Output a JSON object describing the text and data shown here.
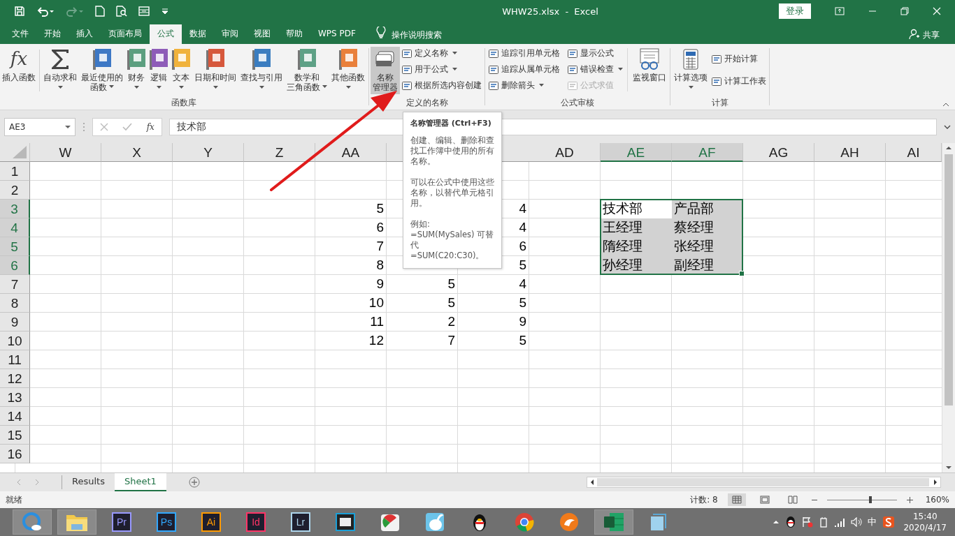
{
  "window": {
    "title": "WHW25.xlsx  -  Excel",
    "login_button": "登录"
  },
  "ribbon_tabs": [
    {
      "label": "文件",
      "selected": false
    },
    {
      "label": "开始",
      "selected": false
    },
    {
      "label": "插入",
      "selected": false
    },
    {
      "label": "页面布局",
      "selected": false
    },
    {
      "label": "公式",
      "selected": true
    },
    {
      "label": "数据",
      "selected": false
    },
    {
      "label": "审阅",
      "selected": false
    },
    {
      "label": "视图",
      "selected": false
    },
    {
      "label": "帮助",
      "selected": false
    },
    {
      "label": "WPS PDF",
      "selected": false
    }
  ],
  "tell_me": "操作说明搜索",
  "share": "共享",
  "ribbon_groups": [
    {
      "label": "函数库",
      "large": [
        {
          "lines": [
            "插入函数"
          ],
          "kind": "glyph",
          "glyph": "fx",
          "dropdown": false,
          "pressed": false
        },
        {
          "lines": [
            "自动求和"
          ],
          "kind": "sum",
          "dropdown": true,
          "pressed": false
        },
        {
          "lines": [
            "最近使用的",
            "函数"
          ],
          "kind": "book",
          "color": "#3d78c5",
          "dropdown": true,
          "pressed": false
        },
        {
          "lines": [
            "财务"
          ],
          "kind": "book",
          "color": "#5c9f7f",
          "dropdown": true,
          "pressed": false
        },
        {
          "lines": [
            "逻辑"
          ],
          "kind": "book",
          "color": "#8e5cb8",
          "dropdown": true,
          "pressed": false
        },
        {
          "lines": [
            "文本"
          ],
          "kind": "book",
          "color": "#f0b23c",
          "dropdown": true,
          "pressed": false
        },
        {
          "lines": [
            "日期和时间"
          ],
          "kind": "book",
          "color": "#d6583c",
          "dropdown": true,
          "pressed": false
        },
        {
          "lines": [
            "查找与引用"
          ],
          "kind": "book",
          "color": "#3a7dc0",
          "dropdown": true,
          "pressed": false
        },
        {
          "lines": [
            "数学和",
            "三角函数"
          ],
          "kind": "book",
          "color": "#5ea186",
          "dropdown": true,
          "pressed": false
        },
        {
          "lines": [
            "其他函数"
          ],
          "kind": "book",
          "color": "#e9803b",
          "dropdown": true,
          "pressed": false
        }
      ]
    },
    {
      "label": "定义的名称",
      "large": [
        {
          "lines": [
            "名称",
            "管理器"
          ],
          "kind": "names",
          "dropdown": false,
          "pressed": true
        }
      ],
      "small": [
        {
          "label": "定义名称",
          "dropdown": true,
          "disabled": false
        },
        {
          "label": "用于公式",
          "dropdown": true,
          "disabled": false
        },
        {
          "label": "根据所选内容创建",
          "dropdown": false,
          "disabled": false
        }
      ]
    },
    {
      "label": "公式审核",
      "small": [
        {
          "label": "追踪引用单元格",
          "dropdown": false,
          "disabled": false
        },
        {
          "label": "追踪从属单元格",
          "dropdown": false,
          "disabled": false
        },
        {
          "label": "删除箭头",
          "dropdown": true,
          "disabled": false
        },
        {
          "label": "显示公式",
          "dropdown": false,
          "disabled": false
        },
        {
          "label": "错误检查",
          "dropdown": true,
          "disabled": false
        },
        {
          "label": "公式求值",
          "dropdown": false,
          "disabled": true
        }
      ],
      "after": [
        {
          "lines": [
            "监视窗口"
          ],
          "kind": "watch",
          "dropdown": false,
          "pressed": false
        }
      ]
    },
    {
      "label": "计算",
      "large": [
        {
          "lines": [
            "计算选项"
          ],
          "kind": "calc",
          "dropdown": true,
          "pressed": false
        }
      ],
      "small": [
        {
          "label": "开始计算",
          "dropdown": false,
          "disabled": false
        },
        {
          "label": "计算工作表",
          "dropdown": false,
          "disabled": false
        }
      ]
    }
  ],
  "formula_bar": {
    "name_box": "AE3",
    "fx": "fx",
    "formula": "技术部"
  },
  "tooltip": {
    "title": "名称管理器 (Ctrl+F3)",
    "paragraphs": [
      "创建、编辑、删除和查找工作簿中使用的所有名称。",
      "可以在公式中使用这些名称，以替代单元格引用。",
      "例如:\n=SUM(MySales) 可替代\n=SUM(C20:C30)。"
    ]
  },
  "columns": [
    {
      "label": "W",
      "selected": false
    },
    {
      "label": "X",
      "selected": false
    },
    {
      "label": "Y",
      "selected": false
    },
    {
      "label": "Z",
      "selected": false
    },
    {
      "label": "AA",
      "selected": false
    },
    {
      "selected": false
    },
    {
      "selected": false
    },
    {
      "label": "AD",
      "selected": false
    },
    {
      "label": "AE",
      "selected": true
    },
    {
      "label": "AF",
      "selected": true
    },
    {
      "label": "AG",
      "selected": false
    },
    {
      "label": "AH",
      "selected": false
    },
    {
      "label": "AI",
      "selected": false
    }
  ],
  "rows": [
    {
      "label": "1",
      "selected": false
    },
    {
      "label": "2",
      "selected": false
    },
    {
      "label": "3",
      "selected": true,
      "cells": [
        null,
        null,
        null,
        null,
        {
          "value": "5",
          "kind": "number"
        },
        null,
        {
          "value": "4",
          "kind": "number"
        },
        null,
        {
          "value": "技术部",
          "kind": "text",
          "active": true
        },
        {
          "value": "产品部",
          "kind": "text",
          "active": false
        }
      ]
    },
    {
      "label": "4",
      "selected": true,
      "cells": [
        null,
        null,
        null,
        null,
        {
          "value": "6",
          "kind": "number"
        },
        null,
        {
          "value": "4",
          "kind": "number"
        },
        null,
        {
          "value": "王经理",
          "kind": "text",
          "active": false
        },
        {
          "value": "蔡经理",
          "kind": "text",
          "active": false
        }
      ]
    },
    {
      "label": "5",
      "selected": true,
      "cells": [
        null,
        null,
        null,
        null,
        {
          "value": "7",
          "kind": "number"
        },
        null,
        {
          "value": "6",
          "kind": "number"
        },
        null,
        {
          "value": "隋经理",
          "kind": "text",
          "active": false
        },
        {
          "value": "张经理",
          "kind": "text",
          "active": false
        }
      ]
    },
    {
      "label": "6",
      "selected": true,
      "cells": [
        null,
        null,
        null,
        null,
        {
          "value": "8",
          "kind": "number"
        },
        null,
        {
          "value": "5",
          "kind": "number"
        },
        null,
        {
          "value": "孙经理",
          "kind": "text",
          "active": false
        },
        {
          "value": "副经理",
          "kind": "text",
          "active": false
        }
      ]
    },
    {
      "label": "7",
      "selected": false,
      "cells": [
        null,
        null,
        null,
        null,
        {
          "value": "9",
          "kind": "number"
        },
        {
          "value": "5",
          "kind": "number"
        },
        {
          "value": "4",
          "kind": "number"
        }
      ]
    },
    {
      "label": "8",
      "selected": false,
      "cells": [
        null,
        null,
        null,
        null,
        {
          "value": "10",
          "kind": "number"
        },
        {
          "value": "5",
          "kind": "number"
        },
        {
          "value": "5",
          "kind": "number"
        }
      ]
    },
    {
      "label": "9",
      "selected": false,
      "cells": [
        null,
        null,
        null,
        null,
        {
          "value": "11",
          "kind": "number"
        },
        {
          "value": "2",
          "kind": "number"
        },
        {
          "value": "9",
          "kind": "number"
        }
      ]
    },
    {
      "label": "10",
      "selected": false,
      "cells": [
        null,
        null,
        null,
        null,
        {
          "value": "12",
          "kind": "number"
        },
        {
          "value": "7",
          "kind": "number"
        },
        {
          "value": "5",
          "kind": "number"
        }
      ]
    },
    {
      "label": "11",
      "selected": false
    },
    {
      "label": "12",
      "selected": false
    },
    {
      "label": "13",
      "selected": false
    },
    {
      "label": "14",
      "selected": false
    },
    {
      "label": "15",
      "selected": false
    },
    {
      "label": "16",
      "selected": false
    }
  ],
  "sheet_tabs": [
    {
      "label": "Results",
      "selected": false
    },
    {
      "label": "Sheet1",
      "selected": true
    }
  ],
  "status_bar": {
    "state": "就绪",
    "count": "计数: 8",
    "zoom": "160%",
    "level": 0.6
  },
  "taskbar": {
    "apps": [
      {
        "kind": "browser",
        "active": true
      },
      {
        "kind": "folder",
        "active": true
      },
      {
        "kind": "letters",
        "label": "Pr",
        "color": "#9999ff",
        "active": false
      },
      {
        "kind": "letters",
        "label": "Ps",
        "color": "#31a8ff",
        "active": false
      },
      {
        "kind": "letters",
        "label": "Ai",
        "color": "#ff9a00",
        "active": false
      },
      {
        "kind": "letters",
        "label": "Id",
        "color": "#ff3366",
        "active": false
      },
      {
        "kind": "letters",
        "label": "Lr",
        "color": "#add5ec",
        "active": false
      },
      {
        "kind": "film",
        "active": false
      },
      {
        "kind": "pie",
        "active": false
      },
      {
        "kind": "bunny",
        "active": false
      },
      {
        "kind": "penguin",
        "active": false
      },
      {
        "kind": "chrome",
        "active": false
      },
      {
        "kind": "cat",
        "active": false
      },
      {
        "kind": "sheet",
        "active": true
      },
      {
        "kind": "notepad",
        "active": false
      }
    ],
    "ime": "中",
    "time": "15:40",
    "date": "2020/4/17"
  }
}
